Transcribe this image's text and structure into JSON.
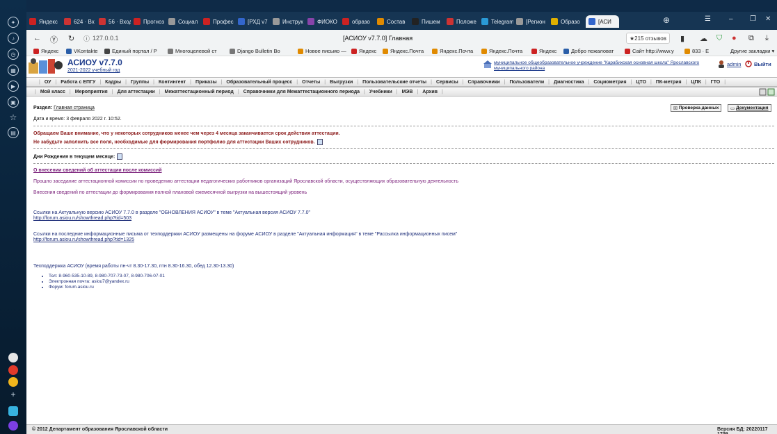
{
  "tabs": [
    {
      "label": "Яндекс",
      "color": "#cc2222"
    },
    {
      "label": "624 · Вх",
      "color": "#cc3333"
    },
    {
      "label": "56 · Вход",
      "color": "#cc3333"
    },
    {
      "label": "Прогноз",
      "color": "#cc2222"
    },
    {
      "label": "Социал",
      "color": "#999999"
    },
    {
      "label": "Профес",
      "color": "#cc2222"
    },
    {
      "label": "[РХД v7",
      "color": "#3366cc"
    },
    {
      "label": "Инструк",
      "color": "#999999"
    },
    {
      "label": "ФИОКО",
      "color": "#8844aa"
    },
    {
      "label": "образо",
      "color": "#cc2222"
    },
    {
      "label": "Состав",
      "color": "#e08a00"
    },
    {
      "label": "Пишем",
      "color": "#222222"
    },
    {
      "label": "Положе",
      "color": "#cc3333"
    },
    {
      "label": "Telegram",
      "color": "#2a9ad6"
    },
    {
      "label": "[Регион",
      "color": "#999999"
    },
    {
      "label": "Образо",
      "color": "#e0b000"
    },
    {
      "label": "[АСИ",
      "color": "#3366cc"
    }
  ],
  "browser": {
    "url": "127.0.0.1",
    "page_title": "[АСИОУ v7.7.0] Главная",
    "reviews": "★215 отзывов"
  },
  "bookmarks": [
    {
      "label": "Яндекс",
      "color": "#cc2222"
    },
    {
      "label": "VKontakte",
      "color": "#2a5ea8"
    },
    {
      "label": "Единый портал / Р",
      "color": "#444444"
    },
    {
      "label": "Многоцелевой ст",
      "color": "#777777"
    },
    {
      "label": "Django Bulletin Bo",
      "color": "#777777"
    },
    {
      "label": "Новое письмо —",
      "color": "#e08a00"
    },
    {
      "label": "Яндекс",
      "color": "#cc2222"
    },
    {
      "label": "Яндекс.Почта",
      "color": "#e08a00"
    },
    {
      "label": "Яндекс.Почта",
      "color": "#e08a00"
    },
    {
      "label": "Яндекс.Почта",
      "color": "#e08a00"
    },
    {
      "label": "Яндекс",
      "color": "#cc2222"
    },
    {
      "label": "Добро пожаловат",
      "color": "#2a5ea8"
    },
    {
      "label": "Сайт http://www.y",
      "color": "#cc2222"
    },
    {
      "label": "833 · Е",
      "color": "#e08a00"
    }
  ],
  "bookmarks_other": "Другие закладки",
  "header": {
    "title": "АСИОУ v7.7.0",
    "year": "2021-2022 учебный год",
    "org": "муниципальное общеобразовательное учреждение \"Карабихская основная школа\" Ярославского муниципального района",
    "user": "admin",
    "logout": "Выйти"
  },
  "menu1": [
    "ОУ",
    "Работа с ЕПГУ",
    "Кадры",
    "Группы",
    "Контингент",
    "Приказы",
    "Образовательный процесс",
    "Отчеты",
    "Выгрузки",
    "Пользовательские отчеты",
    "Сервисы",
    "Справочники",
    "Пользователи",
    "Диагностика",
    "Социометрия",
    "ЦТО",
    "ПК-метрия",
    "ЦПК",
    "ГТО"
  ],
  "menu2": [
    "Мой класс",
    "Мероприятия",
    "Для аттестации",
    "Межаттестационный период",
    "Справочники для Межаттестационного периода",
    "Учебники",
    "МЭВ",
    "Архив"
  ],
  "content": {
    "section_label": "Раздел:",
    "section_value": "Главная страница",
    "check_btn": "Проверка данных",
    "docs_btn": "Документация",
    "datetime": "Дата и время: 3 февраля 2022 г. 10:52.",
    "warn1": "Обращаем Ваше внимание, что у некоторых сотрудников менее чем через 4 месяца заканчивается срок действия аттестации.",
    "warn2": "Не забудьте заполнить все поля, необходимые для формирования портфолио для аттестации Ваших сотрудников.",
    "birthdays": "Дни Рождения в текущем месяце:",
    "news_title": "О внесении сведений об аттестации после комиссий",
    "news1": "Прошло заседание аттестационной комиссии по проведению аттестации педагогических работников организаций Ярославской области, осуществляющих образовательную деятельность",
    "news2": "Внесения сведений по аттестации до формирования полной плановой ежемесячной выгрузки на вышестоящий уровень",
    "link1_text": "Ссылки на Актуальную версию АСИОУ 7.7.0 в разделе \"ОБНОВЛЕНИЯ АСИОУ\" в теме \"Актуальная версия АСИОУ 7.7.0\"",
    "link1_url": "http://forum.asiou.ru/showthread.php?tid=503",
    "link2_text": "Ссылки на последние информационные письма от техподдержки АСИОУ размещены на форуме АСИОУ в разделе \"Актуальная информация\" в теме \"Рассылка информационных писем\"",
    "link2_url": "http://forum.asiou.ru/showthread.php?tid=1325",
    "support_title": "Техподдержка АСИОУ (время работы пн-чт 8.30-17.30, птн 8.30-16.30, обед 12.30-13.30)",
    "support_items": [
      "Тел: 8-960-535-10-89, 8-980-707-73-07, 8-980-706-07-01",
      "Электронная почта: asiou7@yandex.ru",
      "Форум: forum.asiou.ru"
    ]
  },
  "footer": {
    "copyright": "© 2012 Департамент образования Ярославской области",
    "version": "Версия БД: 20220117 1709"
  }
}
